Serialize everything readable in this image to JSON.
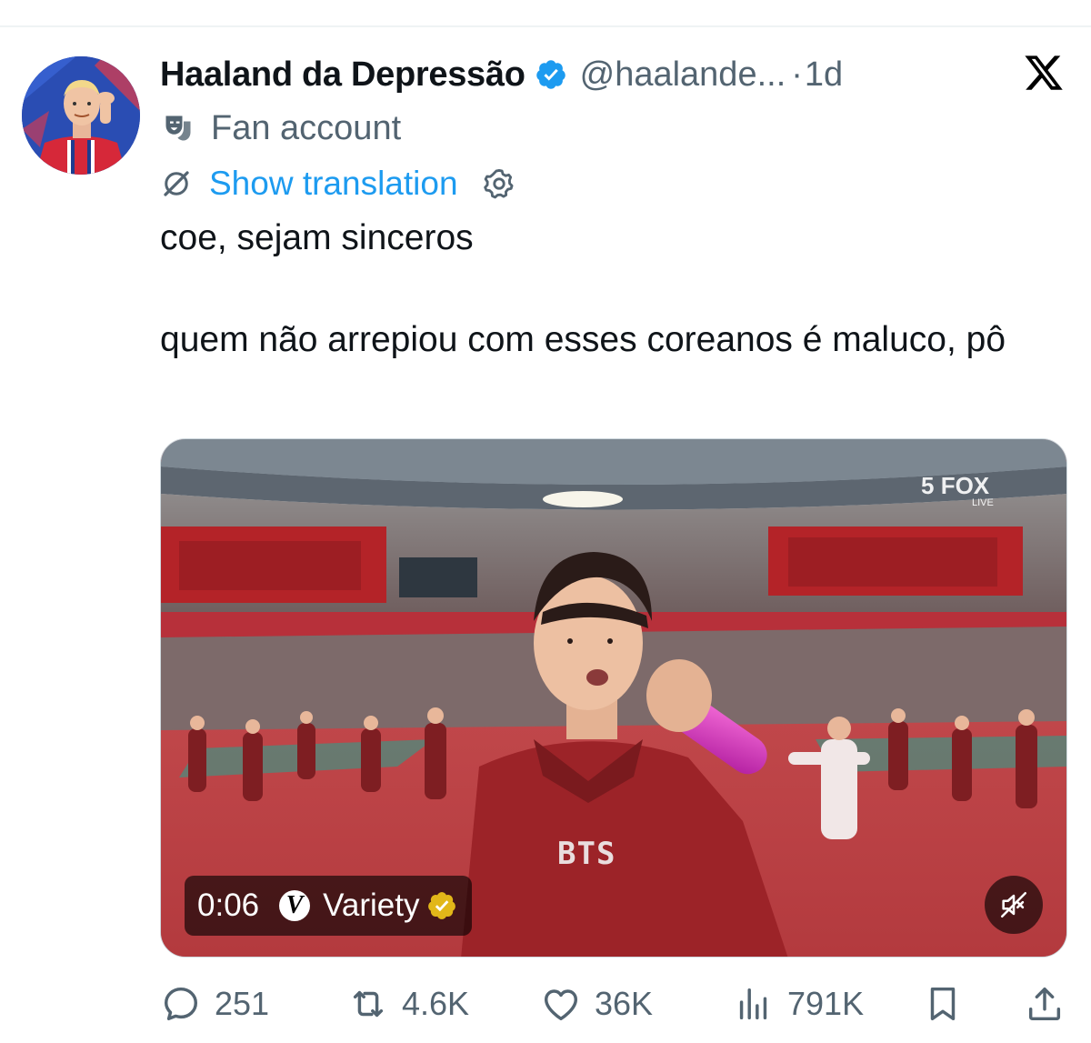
{
  "author": {
    "display_name": "Haaland da Depressão",
    "handle": "@haalande...",
    "separator": "·",
    "time": "1d",
    "verified": true,
    "verified_color": "#1d9bf0",
    "label": "Fan account",
    "label_icon": "theater-masks-icon"
  },
  "translation": {
    "label": "Show translation",
    "icon": "translate-slash-icon",
    "settings_icon": "gear-icon"
  },
  "tweet": {
    "text": "coe, sejam sinceros\n\nquem não arrepiou com esses coreanos é maluco, pô"
  },
  "media": {
    "type": "video",
    "timestamp": "0:06",
    "source": "Variety",
    "source_logo_letter": "V",
    "source_badge_color": "#e2b719",
    "channel_bug": "FOX",
    "channel_number": "5",
    "channel_live": "LIVE",
    "shirt_text": "BTS",
    "muted": true
  },
  "actions": {
    "replies": "251",
    "reposts": "4.6K",
    "likes": "36K",
    "views": "791K"
  },
  "brand": {
    "logo": "x-logo",
    "accent": "#1d9bf0",
    "text_secondary": "#536471"
  }
}
